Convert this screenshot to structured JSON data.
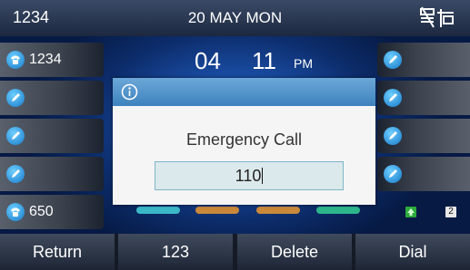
{
  "status_bar": {
    "account": "1234",
    "date": "20 MAY MON",
    "icon": "network-unavailable-icon"
  },
  "clock": {
    "hour": "04",
    "minute": "11",
    "ampm": "PM"
  },
  "left_keys": [
    {
      "label": "1234",
      "icon": "line-phone-icon"
    },
    {
      "label": "",
      "icon": "edit-icon"
    },
    {
      "label": "",
      "icon": "edit-icon"
    },
    {
      "label": "",
      "icon": "edit-icon"
    },
    {
      "label": "650",
      "icon": "line-phone-icon"
    }
  ],
  "right_keys": [
    {
      "label": "",
      "icon": "edit-icon"
    },
    {
      "label": "",
      "icon": "edit-icon"
    },
    {
      "label": "",
      "icon": "edit-icon"
    },
    {
      "label": "",
      "icon": "edit-icon"
    }
  ],
  "page_indicator": {
    "current_icon": "page-up-arrow-icon",
    "page": "2"
  },
  "dialog": {
    "icon": "info-icon",
    "title": "Emergency Call",
    "input_value": "110"
  },
  "softkeys": [
    "Return",
    "123",
    "Delete",
    "Dial"
  ],
  "colors": {
    "dialog_header": "#4a8fc8",
    "input_border": "#7fb5c8",
    "status_bar": "#2a3650"
  }
}
